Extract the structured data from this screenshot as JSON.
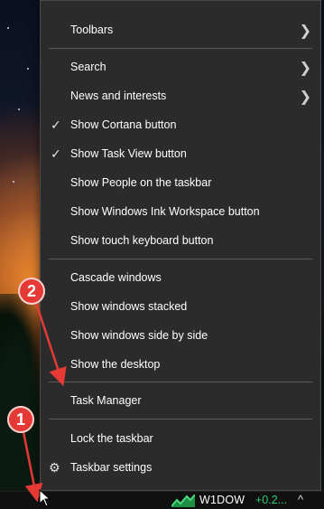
{
  "context_menu": {
    "items": [
      {
        "label": "Toolbars",
        "checked": false,
        "submenu": true,
        "icon": ""
      },
      {
        "label": "Search",
        "checked": false,
        "submenu": true,
        "icon": ""
      },
      {
        "label": "News and interests",
        "checked": false,
        "submenu": true,
        "icon": ""
      },
      {
        "label": "Show Cortana button",
        "checked": true,
        "submenu": false,
        "icon": ""
      },
      {
        "label": "Show Task View button",
        "checked": true,
        "submenu": false,
        "icon": ""
      },
      {
        "label": "Show People on the taskbar",
        "checked": false,
        "submenu": false,
        "icon": ""
      },
      {
        "label": "Show Windows Ink Workspace button",
        "checked": false,
        "submenu": false,
        "icon": ""
      },
      {
        "label": "Show touch keyboard button",
        "checked": false,
        "submenu": false,
        "icon": ""
      },
      {
        "label": "Cascade windows",
        "checked": false,
        "submenu": false,
        "icon": ""
      },
      {
        "label": "Show windows stacked",
        "checked": false,
        "submenu": false,
        "icon": ""
      },
      {
        "label": "Show windows side by side",
        "checked": false,
        "submenu": false,
        "icon": ""
      },
      {
        "label": "Show the desktop",
        "checked": false,
        "submenu": false,
        "icon": ""
      },
      {
        "label": "Task Manager",
        "checked": false,
        "submenu": false,
        "icon": ""
      },
      {
        "label": "Lock the taskbar",
        "checked": false,
        "submenu": false,
        "icon": ""
      },
      {
        "label": "Taskbar settings",
        "checked": false,
        "submenu": false,
        "icon": "gear-icon"
      }
    ],
    "check_glyph": "✓",
    "chevron_glyph": "❯",
    "gear_glyph": "⚙"
  },
  "taskbar": {
    "ticker_symbol": "W1DOW",
    "ticker_change": "+0.2...",
    "tray_chevron": "^",
    "ticker_color": "#2ecc71"
  },
  "annotations": {
    "badge_1": "1",
    "badge_2": "2",
    "badge_color": "#e53935"
  },
  "colors": {
    "menu_bg": "#2b2b2b",
    "menu_border": "#4a4a4a",
    "separator": "#5a5a5a",
    "text": "#ffffff"
  }
}
